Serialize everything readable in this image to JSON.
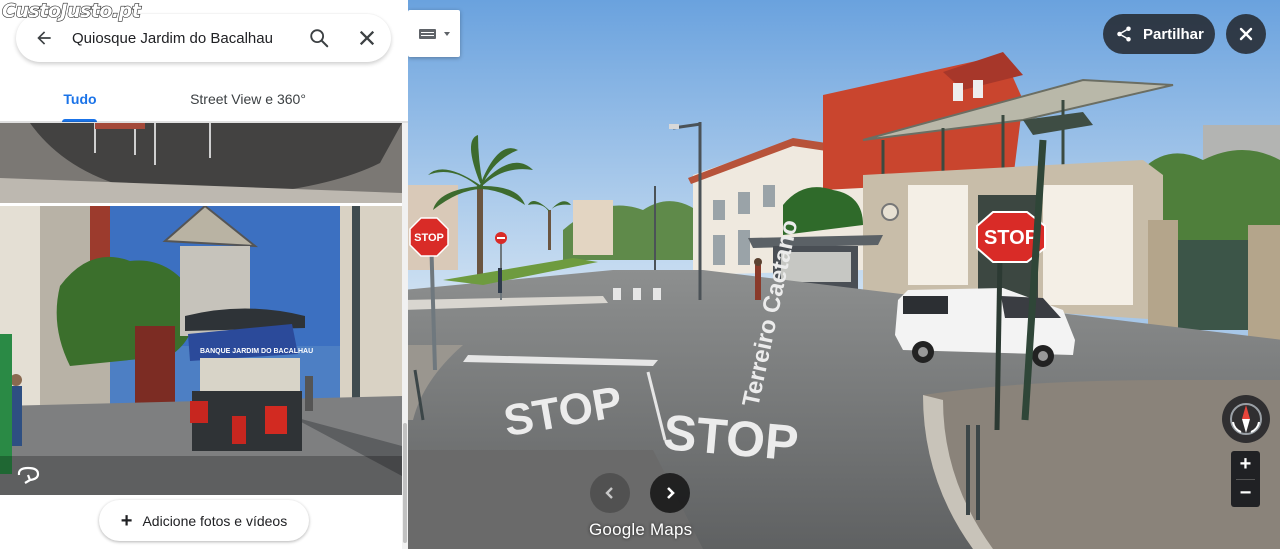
{
  "watermark": "CustoJusto.pt",
  "search": {
    "query": "Quiosque Jardim do Bacalhau"
  },
  "tabs": [
    {
      "label": "Tudo",
      "active": true
    },
    {
      "label": "Street View e 360°",
      "active": false
    }
  ],
  "photos": {
    "add_label": "Adicione fotos e vídeos"
  },
  "streetview": {
    "share_label": "Partilhar",
    "street_name": "Terreiro Caetano",
    "road_text_1": "STOP",
    "road_text_2": "STOP",
    "sign_text": "STOP",
    "photo_sign": "BANQUE JARDIM DO BACALHAU",
    "zoom_in": "+",
    "zoom_out": "−",
    "logo": "Google Maps"
  },
  "colors": {
    "accent": "#1a73e8",
    "dark_button": "#202124"
  },
  "icons": [
    "back-arrow-icon",
    "search-icon",
    "close-icon",
    "keyboard-icon",
    "share-icon",
    "compass-icon",
    "chevron-left-icon",
    "chevron-right-icon",
    "rotate-360-icon",
    "plus-icon"
  ]
}
